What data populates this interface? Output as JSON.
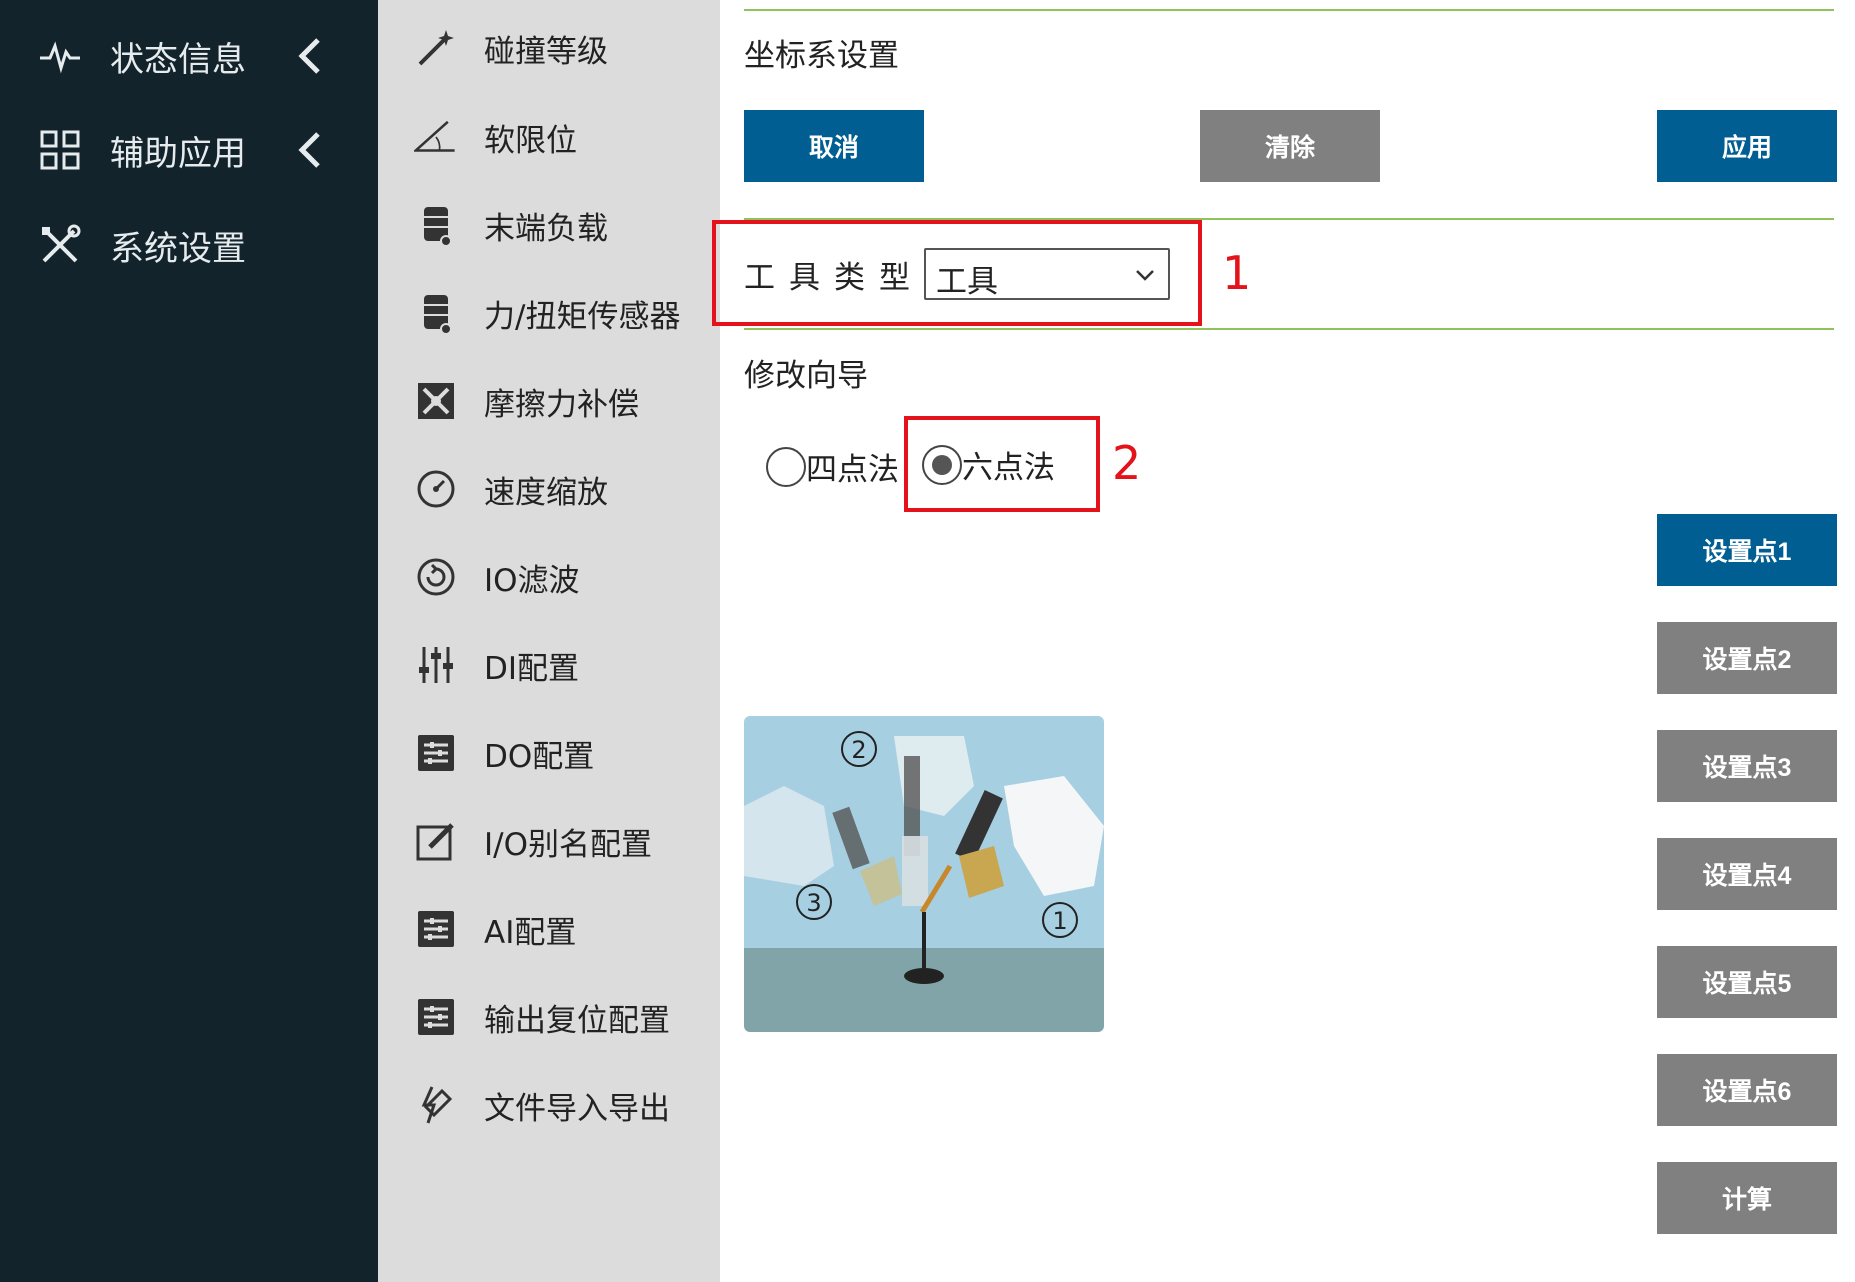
{
  "nav": {
    "items": [
      {
        "label": "状态信息",
        "icon": "pulse-icon"
      },
      {
        "label": "辅助应用",
        "icon": "grid-icon"
      },
      {
        "label": "系统设置",
        "icon": "tools-icon"
      }
    ]
  },
  "submenu": {
    "items": [
      {
        "label": "碰撞等级",
        "icon": "magic-wand-icon"
      },
      {
        "label": "软限位",
        "icon": "angle-icon"
      },
      {
        "label": "末端负载",
        "icon": "database-icon"
      },
      {
        "label": "力/扭矩传感器",
        "icon": "database-icon"
      },
      {
        "label": "摩擦力补偿",
        "icon": "friction-icon"
      },
      {
        "label": "速度缩放",
        "icon": "dashboard-icon"
      },
      {
        "label": "IO滤波",
        "icon": "filter-icon"
      },
      {
        "label": "DI配置",
        "icon": "sliders-icon"
      },
      {
        "label": "DO配置",
        "icon": "settings-list-icon"
      },
      {
        "label": "I/O别名配置",
        "icon": "edit-icon"
      },
      {
        "label": "AI配置",
        "icon": "settings-list-icon"
      },
      {
        "label": "输出复位配置",
        "icon": "settings-list-icon"
      },
      {
        "label": "文件导入导出",
        "icon": "file-transfer-icon"
      }
    ]
  },
  "main": {
    "title": "坐标系设置",
    "buttons": {
      "cancel": "取消",
      "clear": "清除",
      "apply": "应用"
    },
    "tool_type_label": "工具类型",
    "tool_type_value": "工具",
    "wizard_title": "修改向导",
    "radio_four": "四点法",
    "radio_six": "六点法",
    "annotation_1": "1",
    "annotation_2": "2",
    "set_points": [
      "设置点1",
      "设置点2",
      "设置点3",
      "设置点4",
      "设置点5",
      "设置点6"
    ],
    "calculate": "计算",
    "figure_labels": [
      "②",
      "③",
      "①"
    ]
  },
  "colors": {
    "nav_bg": "#13232b",
    "submenu_bg": "#dcdcdc",
    "primary": "#005e93",
    "disabled": "#808080",
    "divider": "#8fc25a",
    "annotation": "#e3121b"
  }
}
